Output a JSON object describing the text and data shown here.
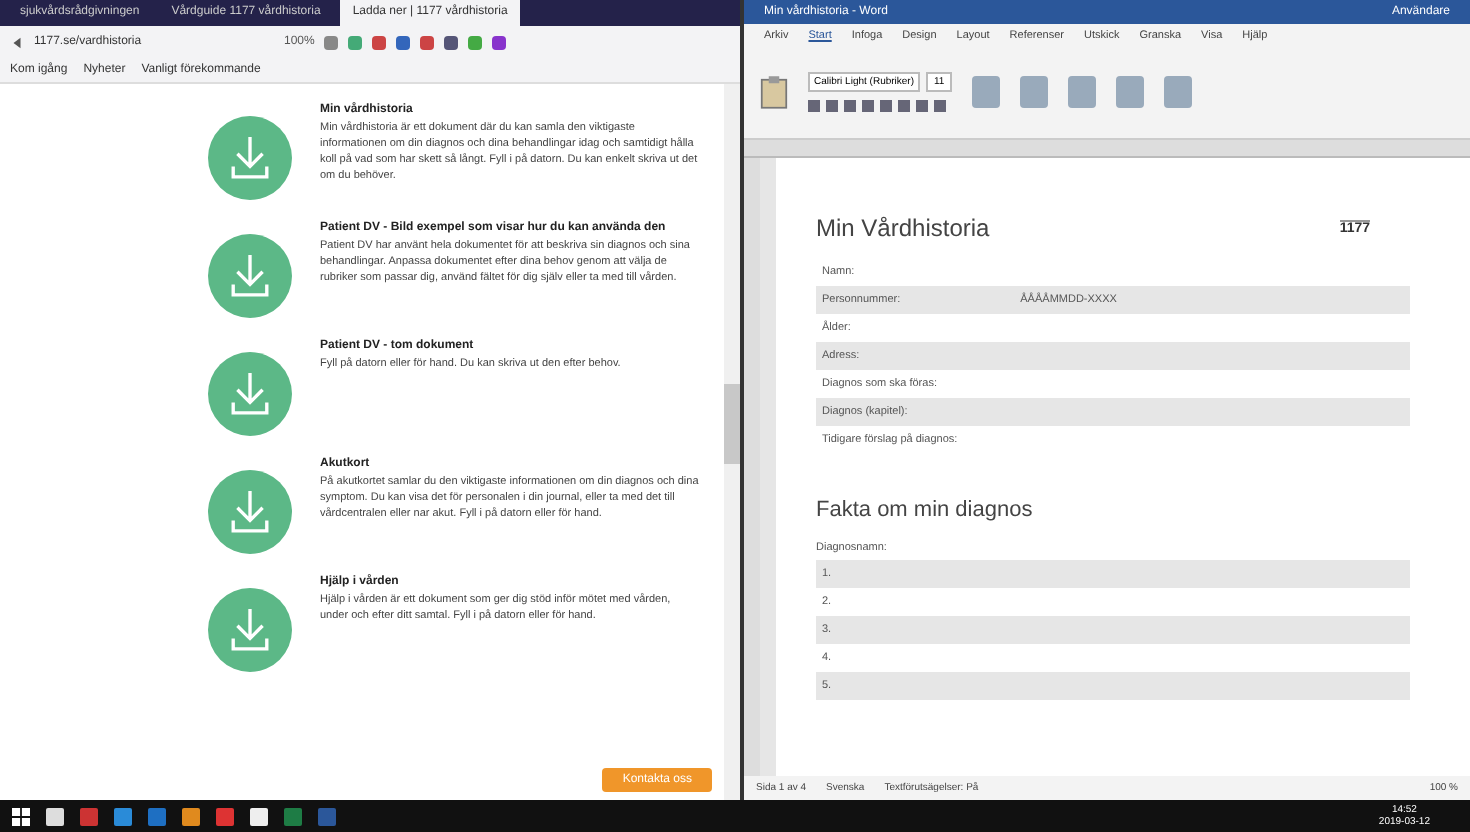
{
  "browser": {
    "tabs": [
      {
        "label": "sjukvårdsrådgivningen",
        "selected": false
      },
      {
        "label": "Vårdguide 1177 vårdhistoria",
        "selected": false
      },
      {
        "label": "Ladda ner | 1177 vårdhistoria",
        "selected": true
      }
    ],
    "address": "1177.se/vardhistoria",
    "zoom": "100%",
    "bookmarks": [
      "Kom igång",
      "Nyheter",
      "Vanligt förekommande"
    ]
  },
  "items": [
    {
      "title": "Min vårdhistoria",
      "text": "Min vårdhistoria är ett dokument där du kan samla den viktigaste informationen om din diagnos och dina behandlingar idag och samtidigt hålla koll på vad som har skett så långt. Fyll i på datorn. Du kan enkelt skriva ut det om du behöver."
    },
    {
      "title": "Patient DV - Bild exempel som visar hur du kan använda den",
      "text": "Patient DV har använt hela dokumentet för att beskriva sin diagnos och sina behandlingar. Anpassa dokumentet efter dina behov genom att välja de rubriker som passar dig, använd fältet för dig själv eller ta med till vården."
    },
    {
      "title": "Patient DV - tom dokument",
      "text": "Fyll på datorn eller för hand. Du kan skriva ut den efter behov."
    },
    {
      "title": "Akutkort",
      "text": "På akutkortet samlar du den viktigaste informationen om din diagnos och dina symptom. Du kan visa det för personalen i din journal, eller ta med det till vårdcentralen eller nar akut. Fyll i på datorn eller för hand."
    },
    {
      "title": "Hjälp i vården",
      "text": "Hjälp i vården är ett dokument som ger dig stöd inför mötet med vården, under och efter ditt samtal. Fyll i på datorn eller för hand."
    }
  ],
  "download_button": "Kontakta oss",
  "word": {
    "title": "Min vårdhistoria - Word",
    "account": "Användare",
    "ribbon_tabs": [
      {
        "label": "Arkiv",
        "selected": false
      },
      {
        "label": "Start",
        "selected": true
      },
      {
        "label": "Infoga",
        "selected": false
      },
      {
        "label": "Design",
        "selected": false
      },
      {
        "label": "Layout",
        "selected": false
      },
      {
        "label": "Referenser",
        "selected": false
      },
      {
        "label": "Utskick",
        "selected": false
      },
      {
        "label": "Granska",
        "selected": false
      },
      {
        "label": "Visa",
        "selected": false
      },
      {
        "label": "Hjälp",
        "selected": false
      }
    ],
    "font": "Calibri Light (Rubriker)",
    "size": "11",
    "doc_title": "Min Vårdhistoria",
    "logo": "1177",
    "fields": [
      {
        "label": "Namn:"
      },
      {
        "label": "Personnummer:",
        "value": "ÅÅÅÅMMDD-XXXX"
      },
      {
        "label": "Ålder:"
      },
      {
        "label": "Adress:"
      },
      {
        "label": "Diagnos som ska föras:"
      },
      {
        "label": "Diagnos (kapitel):"
      },
      {
        "label": "Tidigare förslag på diagnos:"
      }
    ],
    "section_title": "Fakta om min diagnos",
    "list_label": "Diagnosnamn:",
    "list": [
      "1.",
      "2.",
      "3.",
      "4.",
      "5."
    ],
    "status": [
      "Sida 1 av 4",
      "Svenska",
      "Textförutsägelser: På"
    ],
    "zoom": "100 %"
  },
  "clock": {
    "time": "14:52",
    "date": "2019-03-12"
  }
}
